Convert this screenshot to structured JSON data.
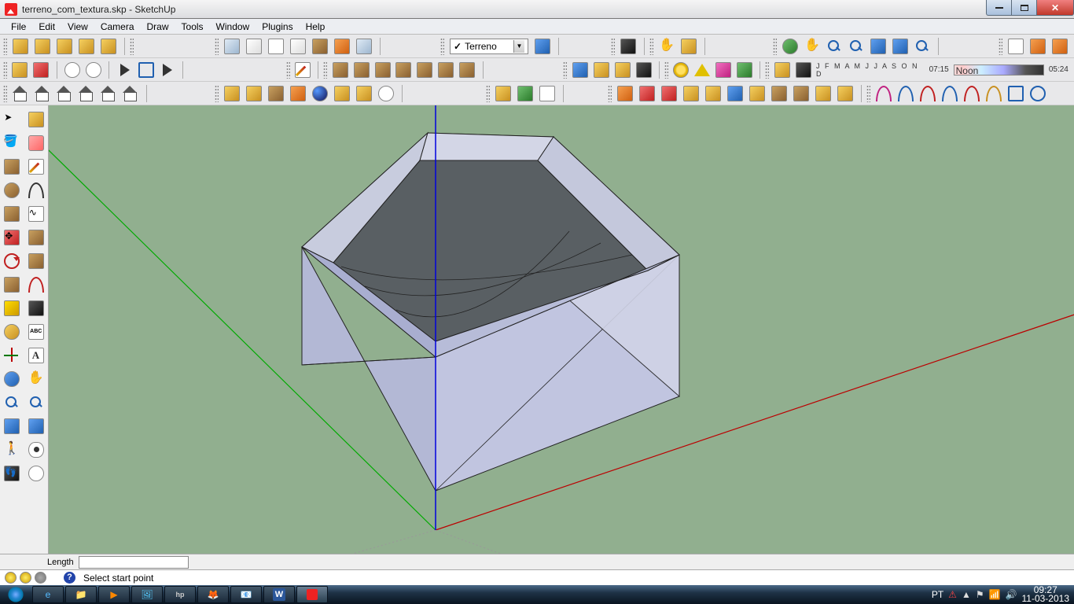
{
  "window": {
    "title": "terreno_com_textura.skp - SketchUp"
  },
  "menu": [
    "File",
    "Edit",
    "View",
    "Camera",
    "Draw",
    "Tools",
    "Window",
    "Plugins",
    "Help"
  ],
  "layer": {
    "selected": "Terreno"
  },
  "time": {
    "months": "J F M A M J J A S O N D",
    "left": "07:15",
    "noon": "Noon",
    "right": "05:24"
  },
  "measurement": {
    "label": "Length",
    "value": ""
  },
  "status": {
    "message": "Select start point"
  },
  "systray": {
    "lang": "PT",
    "time": "09:27",
    "date": "11-03-2013"
  }
}
